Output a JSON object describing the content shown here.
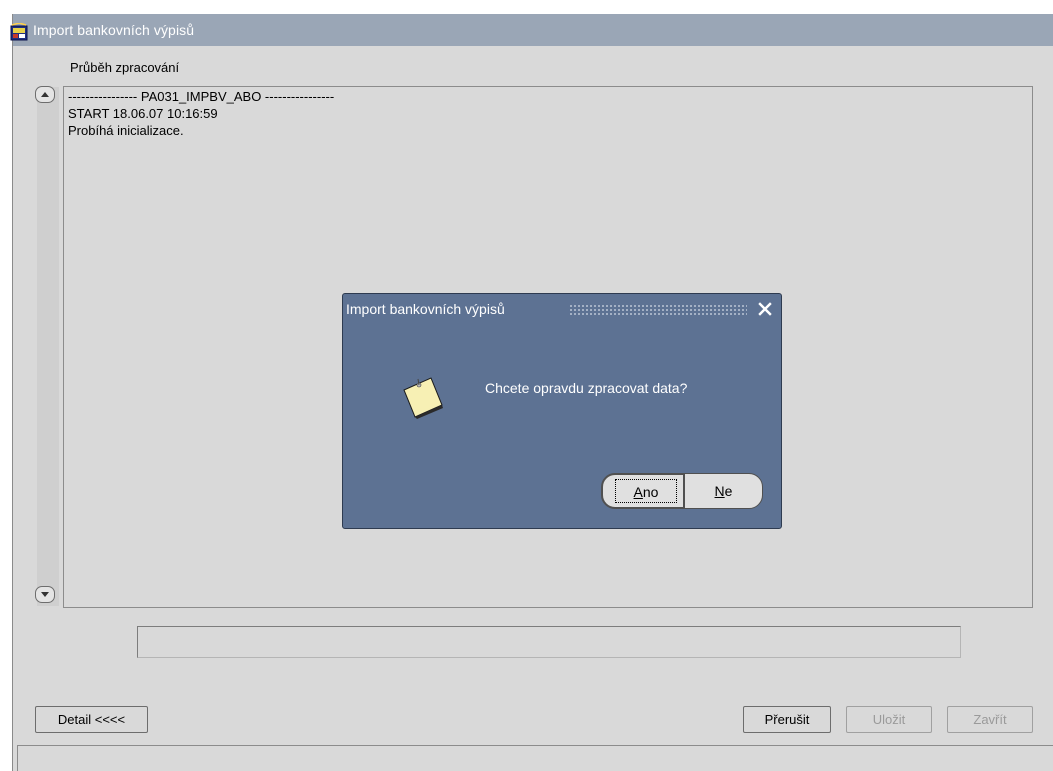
{
  "window": {
    "title": "Import bankovních výpisů",
    "section_label": "Průběh zpracování"
  },
  "log": {
    "lines": [
      "---------------- PA031_IMPBV_ABO ----------------",
      "START 18.06.07 10:16:59",
      "Probíhá inicializace."
    ]
  },
  "progress": {
    "value": ""
  },
  "buttons": {
    "detail": "Detail <<<<",
    "prerusit": "Přerušit",
    "ulozit": "Uložit",
    "zavrit": "Zavřít"
  },
  "dialog": {
    "title": "Import bankovních výpisů",
    "message": "Chcete opravdu zpracovat data?",
    "yes": {
      "mnemonic": "A",
      "rest": "no"
    },
    "no": {
      "mnemonic": "N",
      "rest": "e"
    },
    "icon": "note-icon"
  },
  "colors": {
    "window_bg": "#d9d9d9",
    "titlebar": "#9aa6b6",
    "dialog_bg": "#5d7293"
  }
}
